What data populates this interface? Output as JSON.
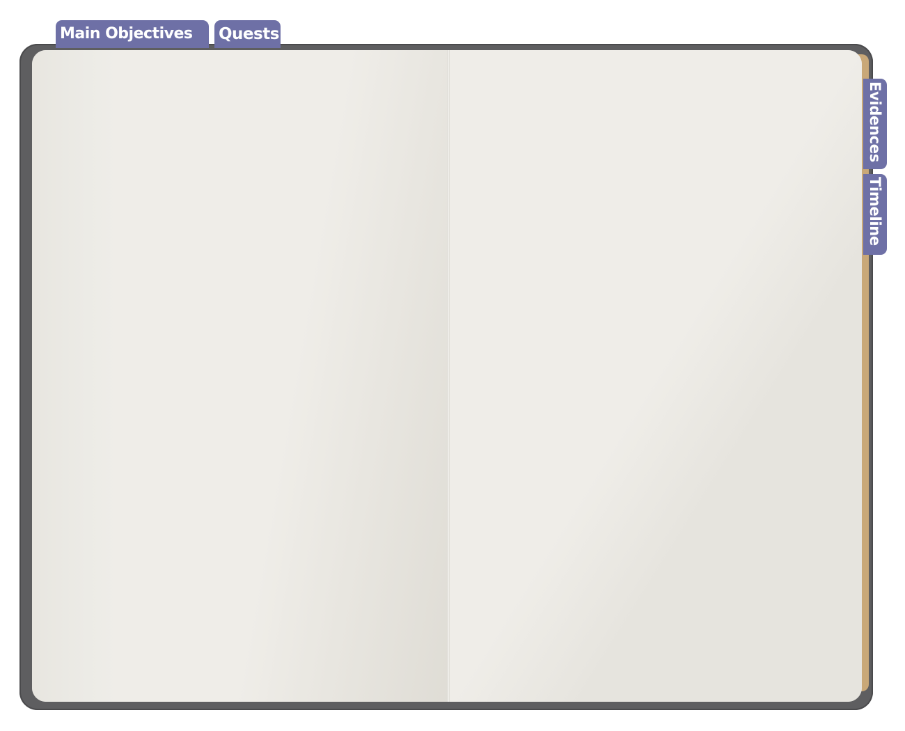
{
  "tabs": {
    "top": [
      {
        "label": "Main Objectives"
      },
      {
        "label": "Quests"
      }
    ],
    "side": [
      {
        "label": "Evidences"
      },
      {
        "label": "Timeline"
      }
    ]
  },
  "colors": {
    "tab": "#6e70a6",
    "tab_text": "#ffffff",
    "cover": "#5e5e60",
    "paper": "#efede8",
    "page_edge": "#c9a878"
  }
}
